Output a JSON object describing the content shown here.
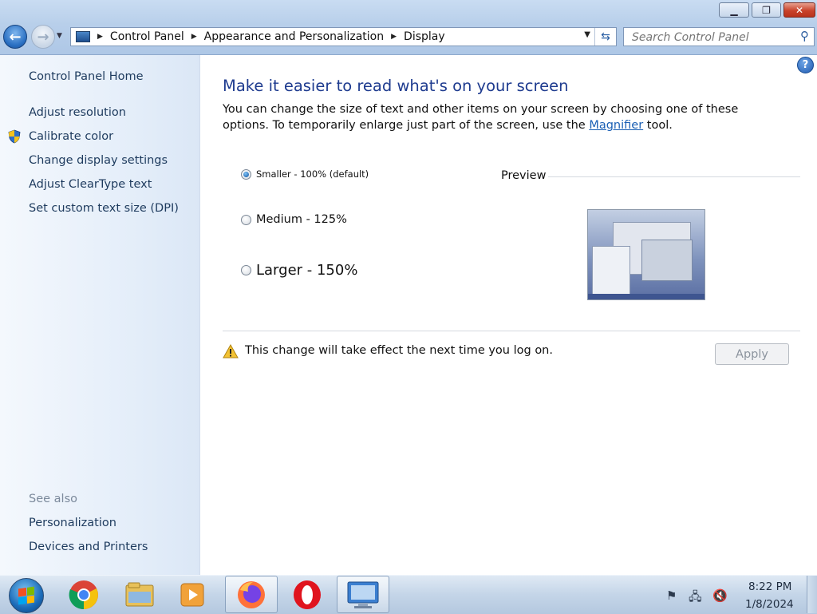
{
  "window": {
    "controls": {
      "minimize": "▁",
      "maximize": "❐",
      "close": "✕"
    }
  },
  "nav": {
    "back_glyph": "←",
    "forward_glyph": "→",
    "history_glyph": "▼"
  },
  "address": {
    "breadcrumbs": [
      "Control Panel",
      "Appearance and Personalization",
      "Display"
    ],
    "separator": "▶",
    "dropdown_glyph": "▼",
    "refresh_glyph": "⇆"
  },
  "search": {
    "placeholder": "Search Control Panel",
    "icon_glyph": "⚲"
  },
  "sidebar": {
    "home": "Control Panel Home",
    "items": [
      {
        "label": "Adjust resolution"
      },
      {
        "label": "Calibrate color",
        "icon": "uac-shield-icon"
      },
      {
        "label": "Change display settings"
      },
      {
        "label": "Adjust ClearType text"
      },
      {
        "label": "Set custom text size (DPI)"
      }
    ],
    "see_also": {
      "heading": "See also",
      "items": [
        "Personalization",
        "Devices and Printers"
      ]
    }
  },
  "main": {
    "help_glyph": "?",
    "title": "Make it easier to read what's on your screen",
    "description_before": "You can change the size of text and other items on your screen by choosing one of these options. To temporarily enlarge just part of the screen, use the ",
    "magnifier_link": "Magnifier",
    "description_after": " tool.",
    "options": [
      {
        "label": "Smaller - 100% (default)",
        "checked": true
      },
      {
        "label": "Medium - 125%",
        "checked": false
      },
      {
        "label": "Larger - 150%",
        "checked": false
      }
    ],
    "preview_label": "Preview",
    "warning": "This change will take effect the next time you log on.",
    "apply_label": "Apply"
  },
  "taskbar": {
    "apps": [
      "chrome-icon",
      "explorer-icon",
      "media-player-icon",
      "firefox-icon",
      "opera-icon",
      "display-settings-icon"
    ],
    "tray": {
      "flag_glyph": "⚑",
      "network_glyph": "🖧",
      "volume_glyph": "🔇",
      "time": "8:22 PM",
      "date": "1/8/2024"
    }
  },
  "colors": {
    "accent": "#1e3b8f",
    "link": "#1a5fb4",
    "sidebar_text": "#1e3b5e",
    "muted": "#7c8a9c"
  }
}
